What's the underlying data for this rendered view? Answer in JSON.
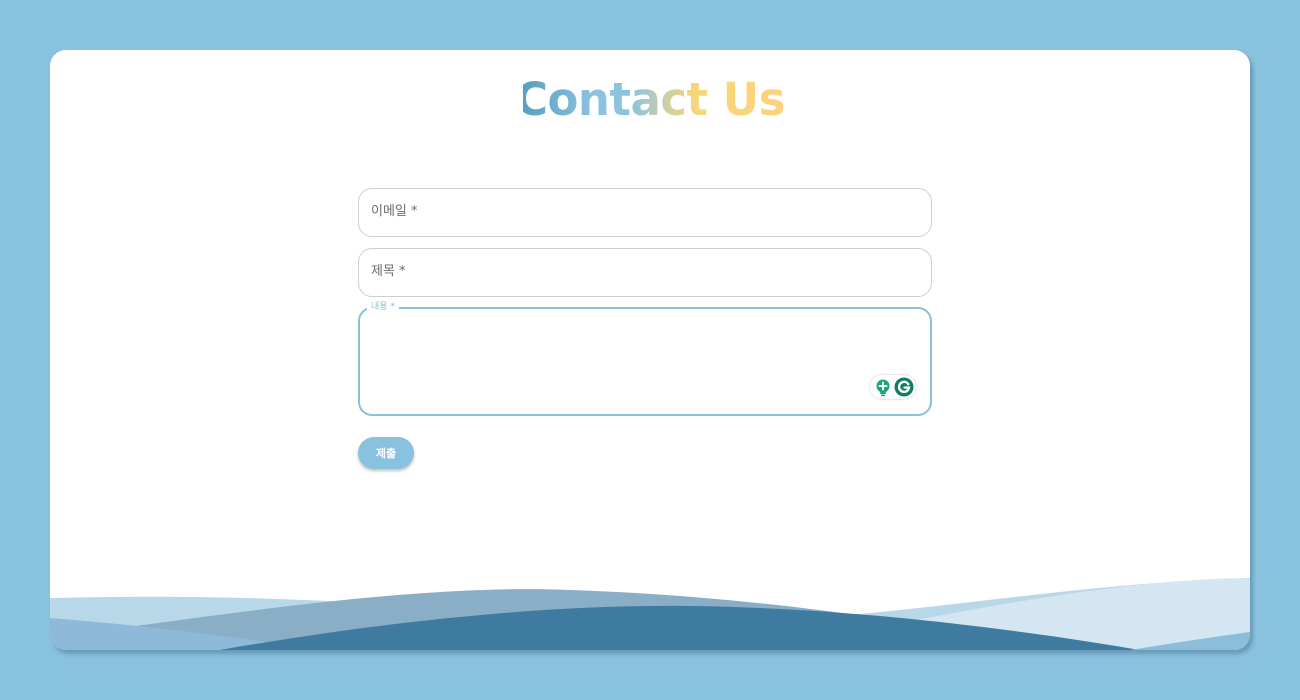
{
  "header": {
    "title": "Contact Us"
  },
  "form": {
    "email_label": "이메일 *",
    "subject_label": "제목 *",
    "content_label": "내용 *",
    "content_value": "",
    "submit_label": "제출"
  },
  "colors": {
    "page_background": "#89c2df",
    "accent": "#89c2d6",
    "title_gradient": [
      "#5a9fc2",
      "#8cc4df",
      "#fdd27c"
    ],
    "wave_dark": "#3f7aa0",
    "grammarly_green": "#15a87a"
  },
  "icons": {
    "grammarly_tip": "lightbulb-icon",
    "grammarly_logo": "grammarly-g-icon"
  }
}
